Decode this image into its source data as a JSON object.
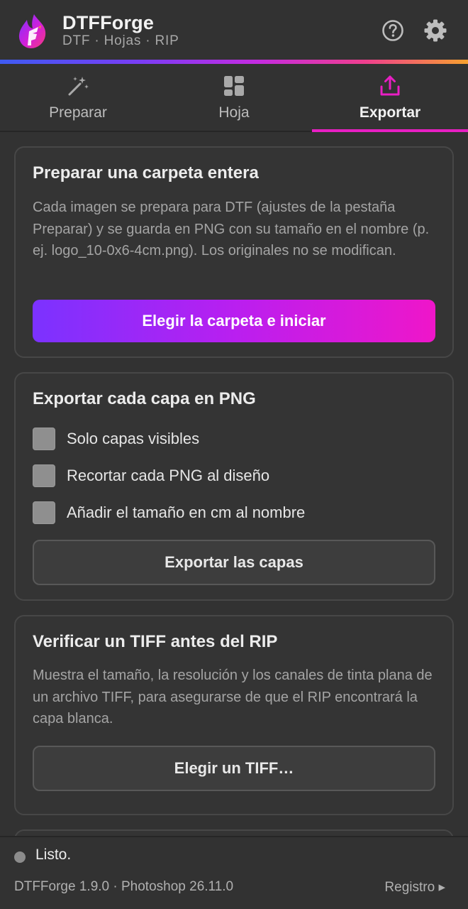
{
  "header": {
    "title": "DTFForge",
    "subtitle": "DTF · Hojas · RIP",
    "help_icon": "help-circle-icon",
    "settings_icon": "gear-icon"
  },
  "tabs": [
    {
      "label": "Preparar",
      "icon": "magic-wand-icon",
      "active": false
    },
    {
      "label": "Hoja",
      "icon": "layout-grid-icon",
      "active": false
    },
    {
      "label": "Exportar",
      "icon": "export-upload-icon",
      "active": true
    }
  ],
  "cards": {
    "folder": {
      "title": "Preparar una carpeta entera",
      "description": "Cada imagen se prepara para DTF (ajustes de la pestaña Preparar) y se guarda en PNG con su tamaño en el nombre (p. ej. logo_10-0x6-4cm.png). Los originales no se modifican.",
      "button_label": "Elegir la carpeta e iniciar"
    },
    "layers": {
      "title": "Exportar cada capa en PNG",
      "options": [
        {
          "label": "Solo capas visibles",
          "checked": false
        },
        {
          "label": "Recortar cada PNG al diseño",
          "checked": false
        },
        {
          "label": "Añadir el tamaño en cm al nombre",
          "checked": false
        }
      ],
      "button_label": "Exportar las capas"
    },
    "tiff": {
      "title": "Verificar un TIFF antes del RIP",
      "description": "Muestra el tamaño, la resolución y los canales de tinta plana de un archivo TIFF, para asegurarse de que el RIP encontrará la capa blanca.",
      "button_label": "Elegir un TIFF…"
    }
  },
  "footer": {
    "status": "Listo.",
    "version": "DTFForge 1.9.0 · Photoshop 26.11.0",
    "log_link": "Registro ▸"
  },
  "colors": {
    "accent": "#e81fc3",
    "primary_gradient_start": "#7b32ff",
    "primary_gradient_end": "#ef16c9",
    "background": "#323232"
  }
}
